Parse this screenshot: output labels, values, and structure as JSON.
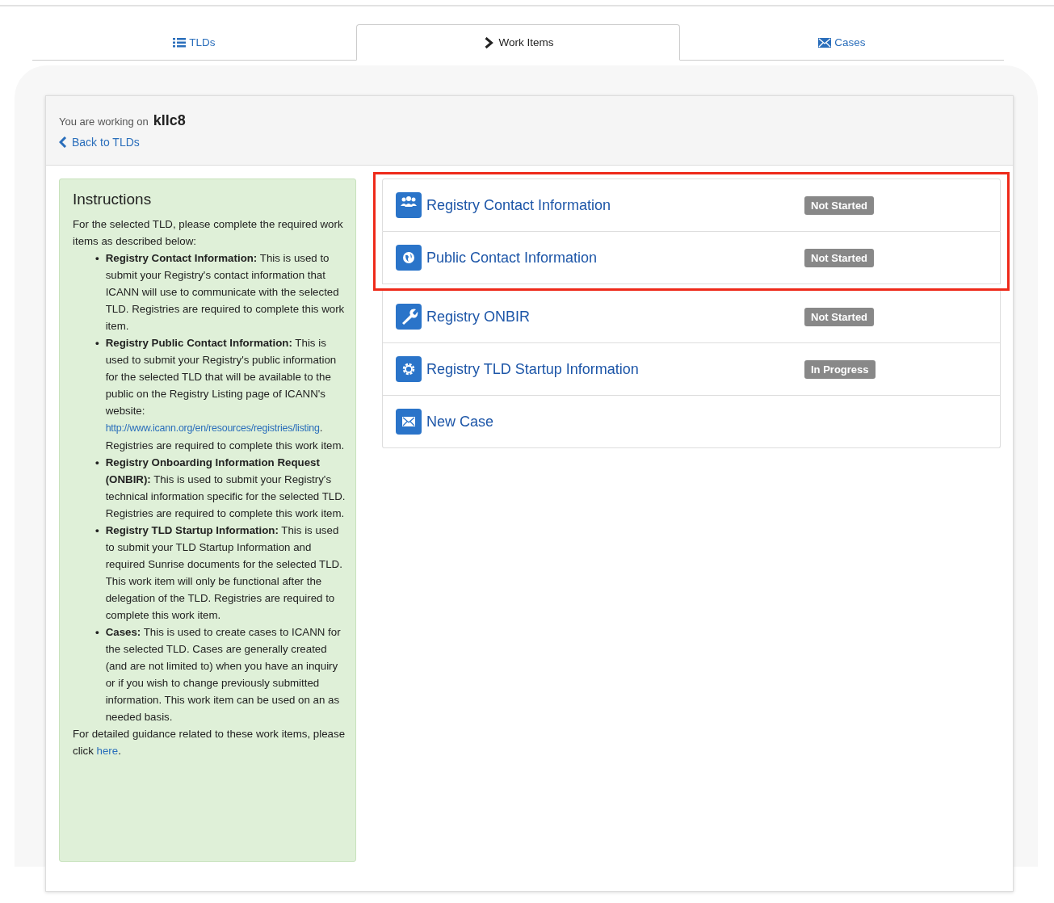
{
  "tabs": [
    {
      "label": "TLDs",
      "kind": "list",
      "selected": false
    },
    {
      "label": "Work Items",
      "kind": "chevron",
      "selected": true
    },
    {
      "label": "Cases",
      "kind": "envelope",
      "selected": false
    }
  ],
  "header": {
    "working_on_label": "You are working on",
    "tld": "kllc8",
    "back_link": "Back to TLDs"
  },
  "instructions": {
    "title": "Instructions",
    "intro": "For the selected TLD, please complete the required work items as described below:",
    "items": [
      {
        "marker": "•",
        "text": "**Registry Contact Information:** This is used to submit your Registry's contact information that ICANN will use to communicate with the selected TLD. Registries are required to complete this work item."
      },
      {
        "marker": "•",
        "text": "**Registry Public Contact Information:** This is used to submit your Registry's public information for the selected TLD that will be available to the public on the Registry Listing page of ICANN's website:",
        "link": "http://www.icann.org/en/resources/registries/listing",
        "after": ". Registries are required to complete this work item."
      },
      {
        "marker": "•",
        "text": "**Registry Onboarding Information Request (ONBIR):** This is used to submit your Registry's technical information specific for the selected TLD. Registries are required to complete this work item."
      },
      {
        "marker": "•",
        "text": "**Registry TLD Startup Information:** This is used to submit your TLD Startup Information and required Sunrise documents for the selected TLD. This work item will only be functional after the delegation of the TLD. Registries are required to complete this work item."
      },
      {
        "marker": "•",
        "text": "**Cases:** This is used to create cases to ICANN for the selected TLD. Cases are generally created (and are not limited to) when you have an inquiry or if you wish to change previously submitted information. This work item can be used on an as needed basis."
      }
    ],
    "footer": "For detailed guidance related to these work items, please click",
    "footer_link": "here",
    "footer_after": "."
  },
  "work_items": [
    {
      "label": "Registry Contact Information",
      "kind": "people",
      "status": "Not Started",
      "highlighted": true
    },
    {
      "label": "Public Contact Information",
      "kind": "globe",
      "status": "Not Started",
      "highlighted": true
    },
    {
      "label": "Registry ONBIR",
      "kind": "wrench",
      "status": "Not Started",
      "highlighted": false
    },
    {
      "label": "Registry TLD Startup Information",
      "kind": "gear",
      "status": "In Progress",
      "highlighted": false
    },
    {
      "label": "New Case",
      "kind": "envelope",
      "highlighted": false
    }
  ]
}
